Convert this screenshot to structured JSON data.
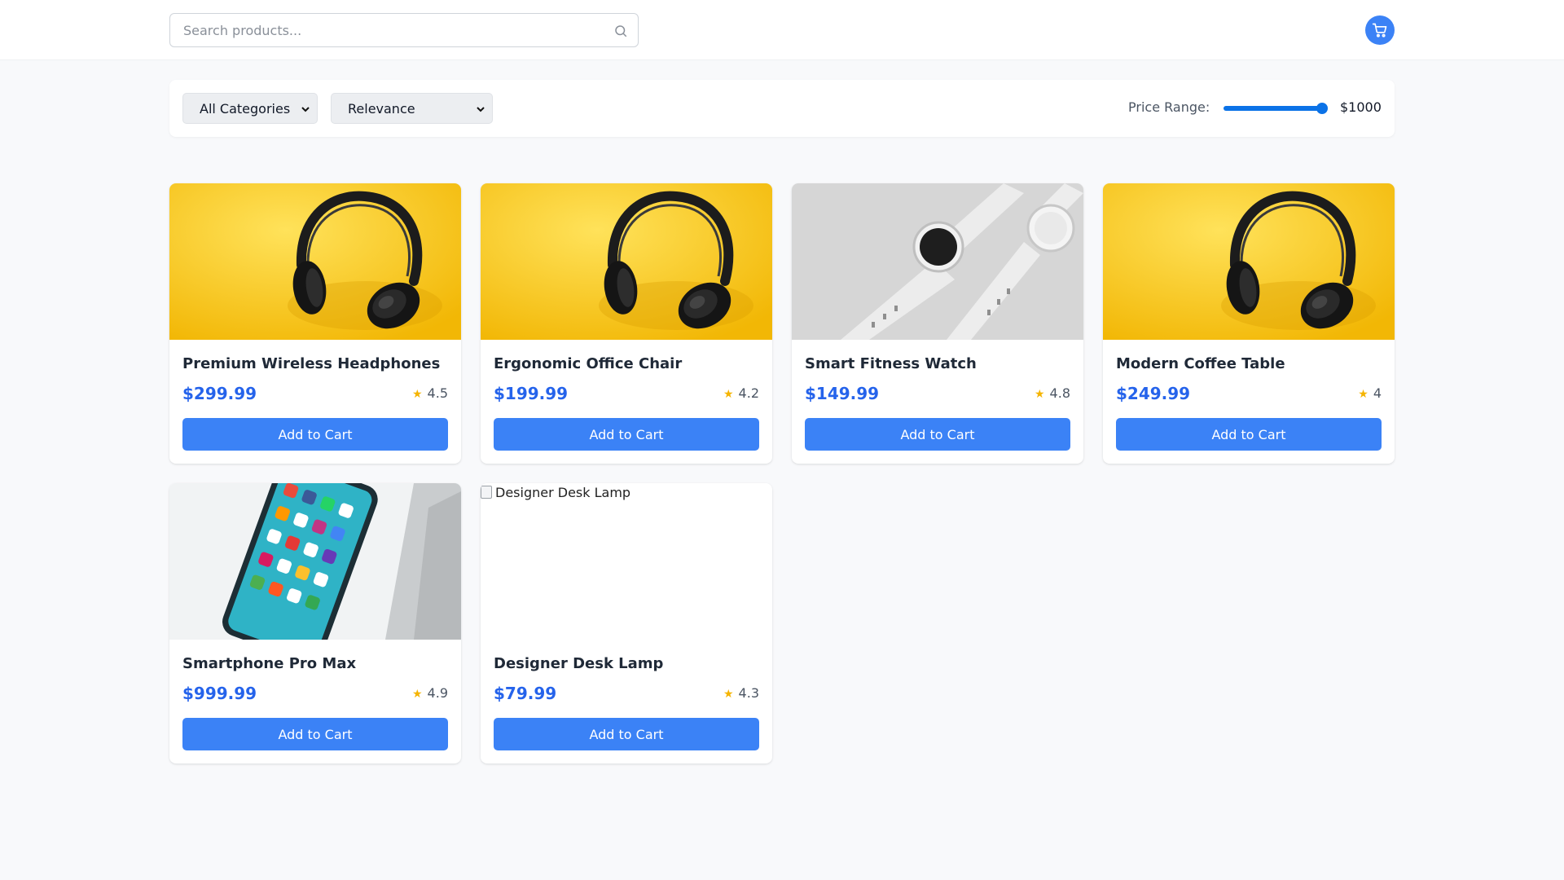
{
  "header": {
    "search": {
      "placeholder": "Search products...",
      "value": ""
    },
    "icons": {
      "search": "search-icon",
      "cart": "shopping-cart-icon"
    },
    "accent_color": "#3b82f6"
  },
  "filters": {
    "category": {
      "selected": "All Categories"
    },
    "sort": {
      "selected": "Relevance"
    },
    "price_range": {
      "label": "Price Range:",
      "value_label": "$1000",
      "fill_fraction": 1.0
    }
  },
  "products": [
    {
      "name": "Premium Wireless Headphones",
      "price": "$299.99",
      "rating": "4.5",
      "button_label": "Add to Cart",
      "image": "headphones"
    },
    {
      "name": "Ergonomic Office Chair",
      "price": "$199.99",
      "rating": "4.2",
      "button_label": "Add to Cart",
      "image": "headphones"
    },
    {
      "name": "Smart Fitness Watch",
      "price": "$149.99",
      "rating": "4.8",
      "button_label": "Add to Cart",
      "image": "watch"
    },
    {
      "name": "Modern Coffee Table",
      "price": "$249.99",
      "rating": "4",
      "button_label": "Add to Cart",
      "image": "headphones"
    },
    {
      "name": "Smartphone Pro Max",
      "price": "$999.99",
      "rating": "4.9",
      "button_label": "Add to Cart",
      "image": "phone"
    },
    {
      "name": "Designer Desk Lamp",
      "price": "$79.99",
      "rating": "4.3",
      "button_label": "Add to Cart",
      "image": "broken",
      "image_alt": "Designer Desk Lamp"
    }
  ],
  "colors": {
    "price": "#2563eb",
    "star": "#f5b400",
    "button": "#3b82f6"
  }
}
